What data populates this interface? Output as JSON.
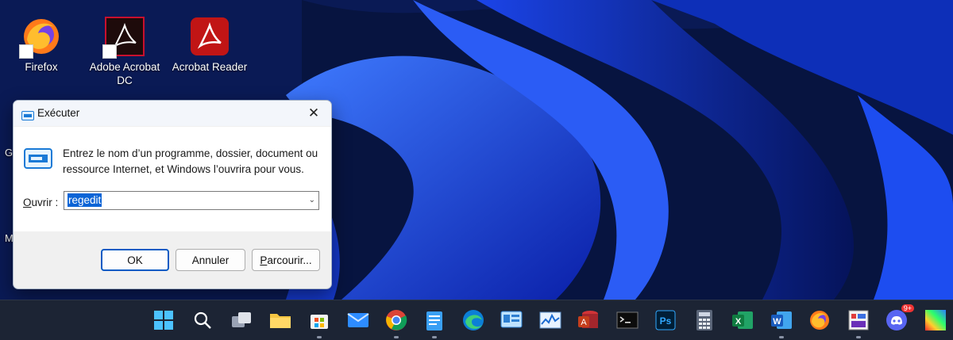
{
  "desktop": {
    "icons": [
      {
        "label": "Firefox",
        "icon": "firefox-icon"
      },
      {
        "label": "Adobe Acrobat DC",
        "icon": "adobe-acrobat-icon"
      },
      {
        "label": "Acrobat Reader",
        "icon": "acrobat-reader-icon"
      }
    ],
    "edge_letters": [
      "G",
      "M"
    ]
  },
  "run_dialog": {
    "title": "Exécuter",
    "close_glyph": "✕",
    "description": "Entrez le nom d’un programme, dossier, document ou ressource Internet, et Windows l’ouvrira pour vous.",
    "open_label_accel": "O",
    "open_label_rest": "uvrir :",
    "input_value": "regedit",
    "buttons": {
      "ok": "OK",
      "cancel": "Annuler",
      "browse_accel": "P",
      "browse_rest": "arcourir..."
    }
  },
  "taskbar": {
    "items": [
      "start-icon",
      "search-icon",
      "task-view-icon",
      "file-explorer-icon",
      "microsoft-store-icon",
      "mail-icon",
      "chrome-icon",
      "notepad-icon",
      "edge-icon",
      "control-panel-icon",
      "performance-monitor-icon",
      "access-icon",
      "terminal-icon",
      "photoshop-icon",
      "calculator-icon",
      "excel-icon",
      "word-icon",
      "firefox-icon",
      "paint-icon",
      "discord-icon",
      "color-icon"
    ],
    "discord_badge": "9+"
  },
  "colors": {
    "accent": "#0b64d6",
    "taskbar": "#1c2434",
    "dialog_bg": "#f0f0f0"
  }
}
